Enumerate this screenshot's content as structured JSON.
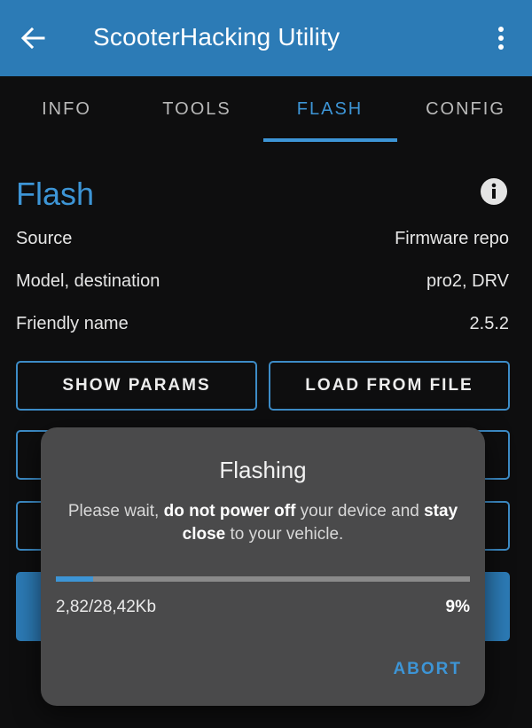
{
  "app": {
    "title": "ScooterHacking Utility",
    "back_icon": "arrow-back-icon",
    "menu_icon": "more-vert-icon",
    "accent": "#3d95d6",
    "appbar_color": "#2c7bb6"
  },
  "tabs": [
    {
      "label": "INFO",
      "active": false
    },
    {
      "label": "TOOLS",
      "active": false
    },
    {
      "label": "FLASH",
      "active": true
    },
    {
      "label": "CONFIG",
      "active": false
    }
  ],
  "flash": {
    "title": "Flash",
    "info_icon": "info-icon",
    "rows": [
      {
        "label": "Source",
        "value": "Firmware repo"
      },
      {
        "label": "Model, destination",
        "value": "pro2, DRV"
      },
      {
        "label": "Friendly name",
        "value": "2.5.2"
      }
    ],
    "buttons": {
      "show_params": "SHOW PARAMS",
      "load_from_file": "LOAD FROM FILE"
    }
  },
  "dialog": {
    "title": "Flashing",
    "msg_1": "Please wait, ",
    "msg_bold_1": "do not power off",
    "msg_2": " your device and ",
    "msg_bold_2": "stay close",
    "msg_3": " to your vehicle.",
    "progress_fraction": 0.09,
    "progress_text": "2,82/28,42Kb",
    "progress_percent": "9%",
    "abort_label": "ABORT"
  }
}
